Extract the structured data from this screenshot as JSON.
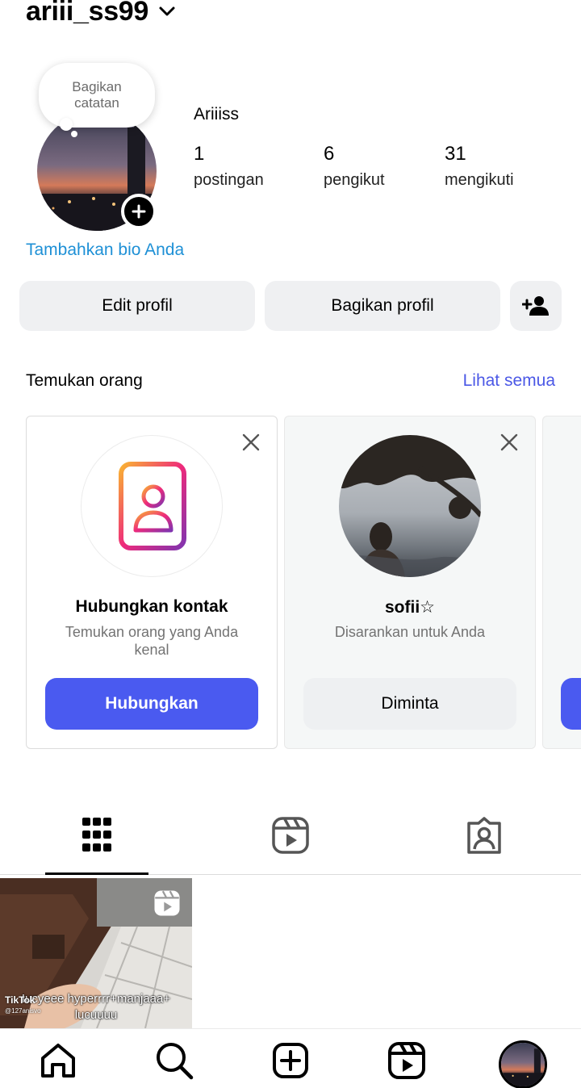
{
  "header": {
    "username": "ariii_ss99"
  },
  "profile": {
    "note_bubble": "Bagikan catatan",
    "display_name": "Ariiiss",
    "stats": [
      {
        "value": "1",
        "label": "postingan"
      },
      {
        "value": "6",
        "label": "pengikut"
      },
      {
        "value": "31",
        "label": "mengikuti"
      }
    ],
    "bio_link": "Tambahkan bio Anda"
  },
  "actions": {
    "edit_label": "Edit profil",
    "share_label": "Bagikan profil"
  },
  "discover": {
    "title": "Temukan orang",
    "see_all": "Lihat semua",
    "cards": [
      {
        "title": "Hubungkan kontak",
        "subtitle": "Temukan orang yang Anda kenal",
        "button": "Hubungkan"
      },
      {
        "title": "sofii☆",
        "subtitle": "Disarankan untuk Anda",
        "button": "Diminta"
      }
    ]
  },
  "post": {
    "caption": "Iucyeee hyperrrr+manjaaa+ lucuuuu",
    "watermark": "TikTok",
    "handle": "@127anisvo"
  },
  "icons": {
    "header": "chevron-down-icon",
    "tabs": [
      "grid-icon",
      "reels-icon",
      "tagged-icon"
    ],
    "nav": [
      "home-icon",
      "search-icon",
      "create-icon",
      "reels-icon",
      "profile-avatar"
    ]
  },
  "colors": {
    "link_blue": "#1e90d6",
    "accent": "#4a5af0",
    "see_all": "#4b58e6",
    "pill_bg": "#eff0f2"
  }
}
